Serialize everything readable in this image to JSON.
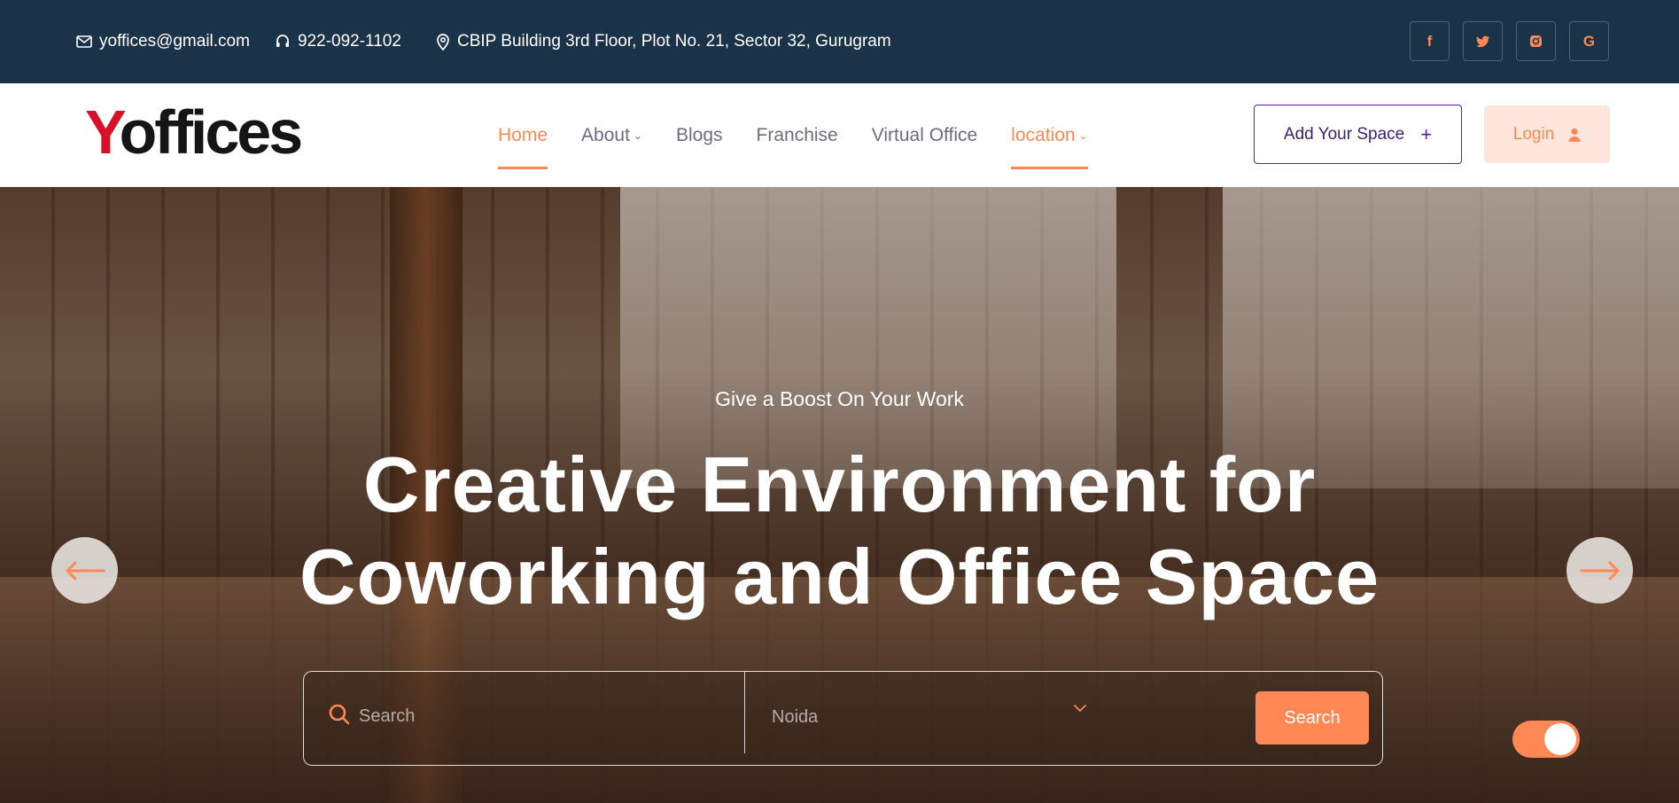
{
  "topbar": {
    "email": "yoffices@gmail.com",
    "phone": "922-092-1102",
    "address": "CBIP Building 3rd Floor, Plot No. 21, Sector 32, Gurugram",
    "socials": [
      {
        "icon": "facebook-icon",
        "glyph": "f"
      },
      {
        "icon": "twitter-icon",
        "glyph": "t"
      },
      {
        "icon": "instagram-icon",
        "glyph": "◎"
      },
      {
        "icon": "google-icon",
        "glyph": "G"
      }
    ]
  },
  "navbar": {
    "logo_y": "Y",
    "logo_rest": "offices",
    "items": [
      {
        "label": "Home",
        "state": "active"
      },
      {
        "label": "About",
        "caret": "⌄"
      },
      {
        "label": "Blogs"
      },
      {
        "label": "Franchise"
      },
      {
        "label": "Virtual Office"
      },
      {
        "label": "location",
        "caret": "⌄"
      }
    ],
    "add_space_label": "Add Your Space",
    "add_space_icon": "+",
    "login_label": "Login"
  },
  "hero": {
    "tagline": "Give a Boost On Your Work",
    "headline_line1": "Creative Environment for",
    "headline_line2": "Coworking and Office Space",
    "search_placeholder": "Search",
    "city_value": "Noida",
    "search_button": "Search"
  },
  "colors": {
    "accent": "#ff8855",
    "topbar_bg": "#1b3349",
    "logo_red": "#d8112a",
    "add_border": "#5b1f9c"
  }
}
